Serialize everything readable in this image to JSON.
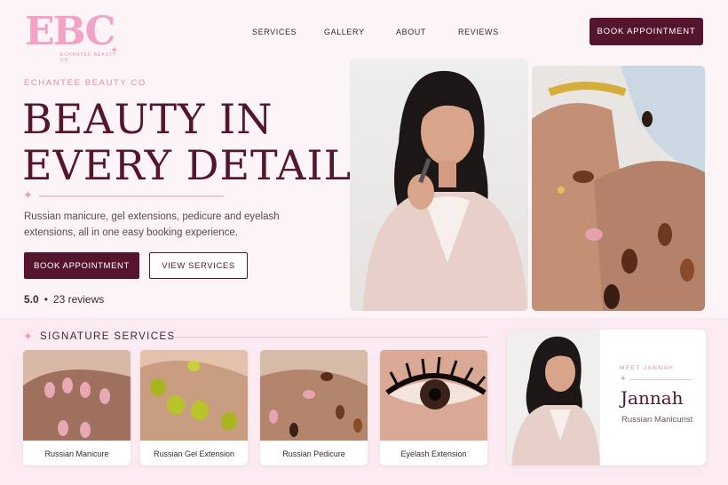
{
  "brand": {
    "logo_letters": "EBC",
    "logo_subtitle": "ECHANTEE BEAUTY CO"
  },
  "nav": {
    "items": [
      "SERVICES",
      "GALLERY",
      "ABOUT",
      "REVIEWS"
    ]
  },
  "header": {
    "book_label": "BOOK APPOINTMENT"
  },
  "hero": {
    "eyebrow": "ECHANTEE BEAUTY CO",
    "title_line1": "BEAUTY IN",
    "title_line2": "EVERY DETAIL",
    "description": "Russian manicure, gel extensions, pedicure and eyelash extensions, all in one easy booking experience.",
    "book_label": "BOOK APPOINTMENT",
    "view_label": "VIEW SERVICES",
    "rating": "5.0",
    "reviews": "23 reviews"
  },
  "services": {
    "title": "SIGNATURE SERVICES",
    "items": [
      {
        "label": "Russian Manicure"
      },
      {
        "label": "Russian Gel Extension"
      },
      {
        "label": "Russian Pedicure"
      },
      {
        "label": "Eyelash Extension"
      }
    ]
  },
  "meet": {
    "eyebrow": "MEET JANNAH",
    "name": "Jannah",
    "role": "Russian Manicurist"
  },
  "colors": {
    "primary": "#55152f",
    "accent_pink": "#f3a2c8",
    "background": "#fdf4f7"
  }
}
